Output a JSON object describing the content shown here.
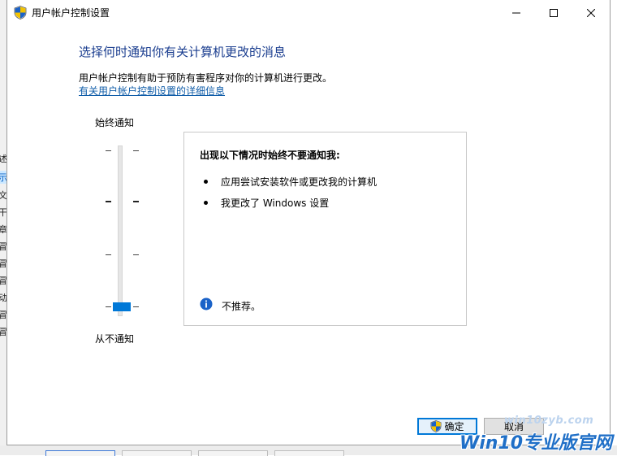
{
  "window": {
    "title": "用户帐户控制设置"
  },
  "main": {
    "heading": "选择何时通知你有关计算机更改的消息",
    "description": "用户帐户控制有助于预防有害程序对你的计算机进行更改。",
    "learn_more_link": "有关用户帐户控制设置的详细信息"
  },
  "slider": {
    "top_label": "始终通知",
    "bottom_label": "从不通知",
    "levels": 4,
    "selected_level": 1
  },
  "panel": {
    "title": "出现以下情况时始终不要通知我:",
    "bullets": [
      "应用尝试安装软件或更改我的计算机",
      "我更改了 Windows 设置"
    ],
    "info_text": "不推荐。"
  },
  "buttons": {
    "ok_label": "确定",
    "cancel_label": "取消"
  },
  "background_fragments": [
    "述",
    "示",
    "文",
    "干",
    "章",
    "冒",
    "冒",
    "冒",
    "动",
    "冒",
    "冒"
  ],
  "watermark": {
    "url": "win10zyb.com",
    "brand": "Win10专业版官网"
  },
  "colors": {
    "accent": "#0078d7",
    "heading": "#1a3d8f",
    "link": "#0f5ca8"
  }
}
